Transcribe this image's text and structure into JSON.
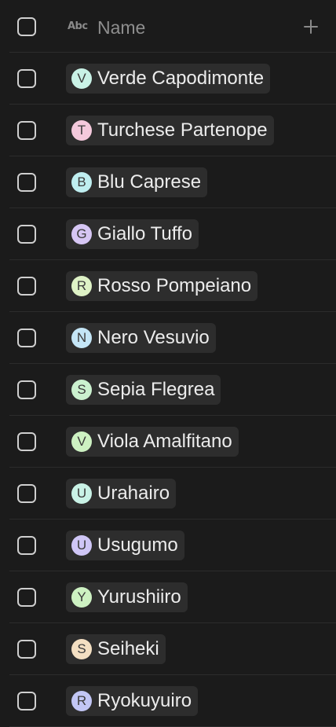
{
  "header": {
    "type_icon": "Abc",
    "column_title": "Name"
  },
  "rows": [
    {
      "initial": "V",
      "name": "Verde Capodimonte",
      "avatar_color": "#c9f2e6"
    },
    {
      "initial": "T",
      "name": "Turchese Partenope",
      "avatar_color": "#f4c9dc"
    },
    {
      "initial": "B",
      "name": "Blu Caprese",
      "avatar_color": "#bfeef0"
    },
    {
      "initial": "G",
      "name": "Giallo Tuffo",
      "avatar_color": "#d6c6f4"
    },
    {
      "initial": "R",
      "name": "Rosso Pompeiano",
      "avatar_color": "#def2c6"
    },
    {
      "initial": "N",
      "name": "Nero Vesuvio",
      "avatar_color": "#c4e5f6"
    },
    {
      "initial": "S",
      "name": "Sepia Flegrea",
      "avatar_color": "#cbf1cf"
    },
    {
      "initial": "V",
      "name": "Viola Amalfitano",
      "avatar_color": "#cdf1c2"
    },
    {
      "initial": "U",
      "name": "Urahairo",
      "avatar_color": "#c9f2e6"
    },
    {
      "initial": "U",
      "name": "Usugumo",
      "avatar_color": "#cfc6f6"
    },
    {
      "initial": "Y",
      "name": "Yurushiiro",
      "avatar_color": "#cdf1c2"
    },
    {
      "initial": "S",
      "name": "Seiheki",
      "avatar_color": "#f3dfc2"
    },
    {
      "initial": "R",
      "name": "Ryokuyuiro",
      "avatar_color": "#c2c6f5"
    }
  ]
}
